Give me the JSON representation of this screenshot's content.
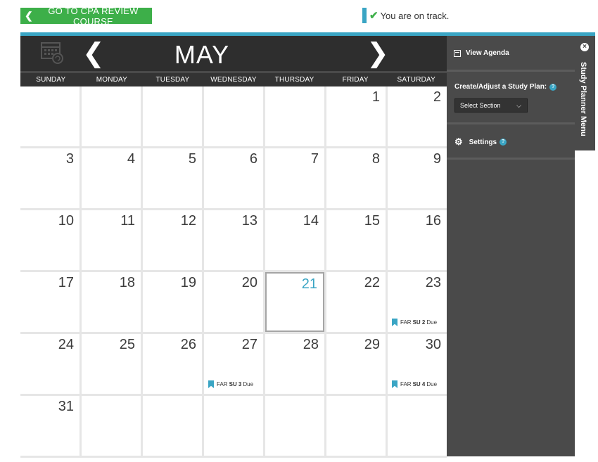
{
  "top": {
    "goto_label": "GO TO CPA REVIEW COURSE",
    "status_text": "You are on track."
  },
  "calendar": {
    "month": "MAY",
    "days_of_week": [
      "SUNDAY",
      "MONDAY",
      "TUESDAY",
      "WEDNESDAY",
      "THURSDAY",
      "FRIDAY",
      "SATURDAY"
    ],
    "weeks": [
      [
        "",
        "",
        "",
        "",
        "",
        "1",
        "2"
      ],
      [
        "3",
        "4",
        "5",
        "6",
        "7",
        "8",
        "9"
      ],
      [
        "10",
        "11",
        "12",
        "13",
        "14",
        "15",
        "16"
      ],
      [
        "17",
        "18",
        "19",
        "20",
        "21",
        "22",
        "23"
      ],
      [
        "24",
        "25",
        "26",
        "27",
        "28",
        "29",
        "30"
      ],
      [
        "31",
        "",
        "",
        "",
        "",
        "",
        ""
      ]
    ],
    "today": "21",
    "events": [
      {
        "day": "23",
        "pre": "FAR",
        "bold": "SU 2",
        "post": "Due"
      },
      {
        "day": "27",
        "pre": "FAR",
        "bold": "SU 3",
        "post": "Due"
      },
      {
        "day": "30",
        "pre": "FAR",
        "bold": "SU 4",
        "post": "Due"
      }
    ]
  },
  "panel": {
    "tab_label": "Study Planner Menu",
    "view_agenda": "View Agenda",
    "plan_label": "Create/Adjust a Study Plan:",
    "select_value": "Select Section",
    "settings_label": "Settings",
    "help_glyph": "?",
    "close_glyph": "×"
  },
  "colors": {
    "accent": "#3aa5c4",
    "green": "#3daf49",
    "dark": "#2e2e2e",
    "panel": "#4a4a4a"
  }
}
